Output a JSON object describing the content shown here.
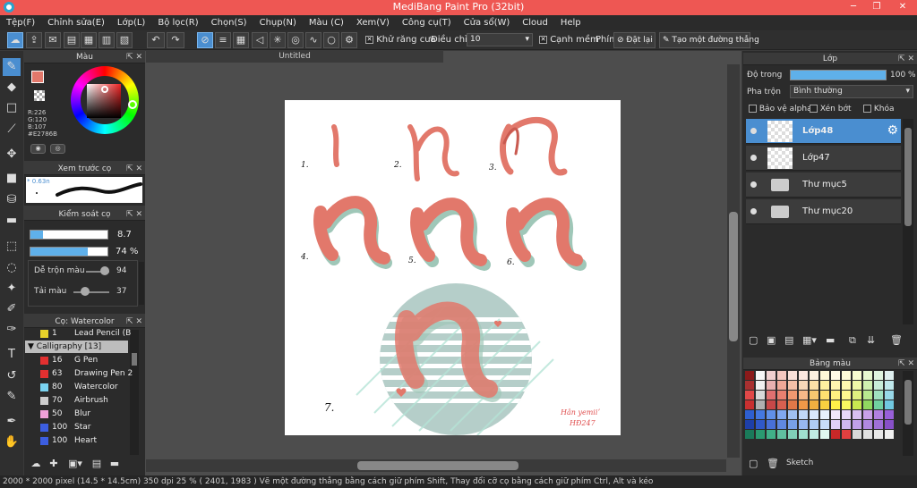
{
  "window": {
    "title": "MediBang Paint Pro (32bit)"
  },
  "menu": [
    "Tệp(F)",
    "Chỉnh sửa(E)",
    "Lớp(L)",
    "Bộ lọc(R)",
    "Chọn(S)",
    "Chụp(N)",
    "Màu (C)",
    "Xem(V)",
    "Công cụ(T)",
    "Cửa sổ(W)",
    "Cloud",
    "Help"
  ],
  "toolbar": {
    "antialias_label": "Khử răng cưa",
    "adjust_label": "Điều chỉnh",
    "adjust_value": "10",
    "soft_edge_label": "Cạnh mềm",
    "key_label": "Phím",
    "reset_label": "Đặt lại",
    "line_label": "Tạo một đường thẳng"
  },
  "color_panel": {
    "title": "Màu",
    "r": "R:226",
    "g": "G:120",
    "b": "B:107",
    "hex": "#E2786B",
    "primary_color": "#e2786b"
  },
  "brush_preview": {
    "title": "Xem trước cọ",
    "size": "* 0.63n"
  },
  "brush_control": {
    "title": "Kiểm soát cọ",
    "size_value": "8.7",
    "opacity_value": "74 %",
    "blend_label": "Dễ trộn màu",
    "blend_value": "94",
    "load_label": "Tải màu",
    "load_value": "37"
  },
  "brush_list": {
    "title": "Cọ: Watercolor",
    "group": "Calligraphy [13]",
    "items": [
      {
        "size": "1",
        "name": "Lead Pencil (B",
        "color": "#e8d22a"
      },
      {
        "size": "16",
        "name": "G Pen",
        "color": "#e23030"
      },
      {
        "size": "63",
        "name": "Drawing Pen 2",
        "color": "#e23030"
      },
      {
        "size": "80",
        "name": "Watercolor",
        "color": "#7ad3f0"
      },
      {
        "size": "70",
        "name": "Airbrush",
        "color": "#cccccc"
      },
      {
        "size": "50",
        "name": "Blur",
        "color": "#f0a0d8"
      },
      {
        "size": "100",
        "name": "Star",
        "color": "#3c5ee0"
      },
      {
        "size": "100",
        "name": "Heart",
        "color": "#3c5ee0"
      }
    ]
  },
  "document": {
    "tab": "Untitled",
    "labels": [
      "1.",
      "2.",
      "3.",
      "4.",
      "5.",
      "6.",
      "7."
    ],
    "signature_line1": "Hân yemiiʼ",
    "signature_line2": "HĐ247"
  },
  "layer_panel": {
    "title": "Lớp",
    "opacity_label": "Độ trong",
    "opacity_value": "100 %",
    "opacity_fraction": 1.0,
    "blend_label": "Pha trộn",
    "blend_value": "Bình thường",
    "protect_alpha": "Bảo vệ alpha",
    "clipping": "Xén bớt",
    "lock": "Khóa",
    "layers": [
      {
        "name": "Lớp48",
        "type": "layer",
        "selected": true
      },
      {
        "name": "Lớp47",
        "type": "layer",
        "selected": false
      },
      {
        "name": "Thư mục5",
        "type": "folder",
        "selected": false
      },
      {
        "name": "Thư mục20",
        "type": "folder",
        "selected": false
      }
    ]
  },
  "palette": {
    "title": "Bảng màu",
    "footer_label": "Sketch",
    "colors": [
      "#8b1a1a",
      "#f6f6f6",
      "#f0d0d0",
      "#f4c8c0",
      "#f8e0d8",
      "#fce8e0",
      "#fcf0e0",
      "#fff8d8",
      "#fffae8",
      "#fffcd8",
      "#f8fcd0",
      "#e8f8d0",
      "#e0f4e0",
      "#e0f0f0",
      "#a83030",
      "#f0f0f0",
      "#e8b0b0",
      "#f0a898",
      "#f4c0a8",
      "#f8d8b8",
      "#fce0a8",
      "#fff0a0",
      "#fff4b0",
      "#fff8b0",
      "#f0f8a8",
      "#d0f0b0",
      "#c8ecd8",
      "#c0e8ec",
      "#e04848",
      "#d8d8d8",
      "#e07070",
      "#e88070",
      "#f09870",
      "#f8b888",
      "#f8c870",
      "#ffe070",
      "#fff080",
      "#fff890",
      "#e0f080",
      "#b8e890",
      "#a0e0c0",
      "#98d8e8",
      "#c83030",
      "#b0b0b0",
      "#c84848",
      "#d86050",
      "#e07848",
      "#f09848",
      "#f0b040",
      "#f8d040",
      "#fff048",
      "#f8f860",
      "#c8e850",
      "#90d860",
      "#70d0a0",
      "#70c8e0",
      "#2e5fd0",
      "#4478e0",
      "#6090e8",
      "#80a8f0",
      "#a0c0f0",
      "#c0d8f8",
      "#d8e8fc",
      "#e8f0fc",
      "#f0e8fc",
      "#e8d8f8",
      "#d8c0f0",
      "#c8a0e8",
      "#b080e0",
      "#9860d8",
      "#1e3fa8",
      "#3058c8",
      "#4870d8",
      "#6088e0",
      "#78a0e8",
      "#98b8f0",
      "#b0ccf4",
      "#c8dcf8",
      "#e0d0f8",
      "#d0b8f0",
      "#c0a0e8",
      "#b088e0",
      "#a070d8",
      "#8850c8",
      "#1a7a5a",
      "#2a9a70",
      "#40b088",
      "#60c0a0",
      "#80d0b8",
      "#a0e0d0",
      "#c0ece4",
      "#e0f8f0",
      "#c82828",
      "#e04040",
      "#d8d8d8",
      "#e0e0e0",
      "#e8e8e8",
      "#f0f0f0"
    ]
  },
  "status": {
    "text": "2000 * 2000 pixel   (14.5 * 14.5cm)   350 dpi   25 %   ( 2401, 1983 )   Vẽ một đường thẳng bằng cách giữ phím Shift, Thay đổi cỡ cọ bằng cách giữ phím Ctrl, Alt và kéo"
  },
  "colors": {
    "accent": "#4a8ed0",
    "title_bar": "#ee5753",
    "stroke": "#e2786b",
    "stroke_shadow": "#9fc7b8",
    "circle": "#b5cec9"
  }
}
